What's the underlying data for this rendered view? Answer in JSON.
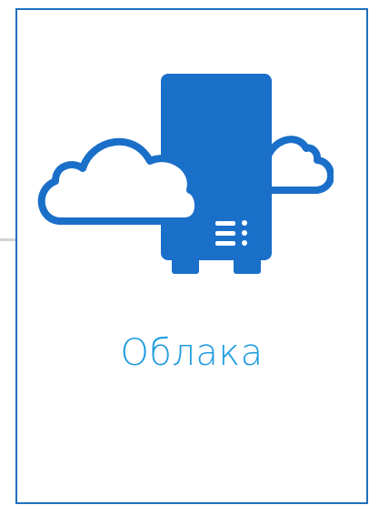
{
  "tile": {
    "label": "Облака",
    "icon": "cloud-server-icon",
    "accent_color": "#1a6fc9",
    "label_color": "#1e9bdf"
  }
}
